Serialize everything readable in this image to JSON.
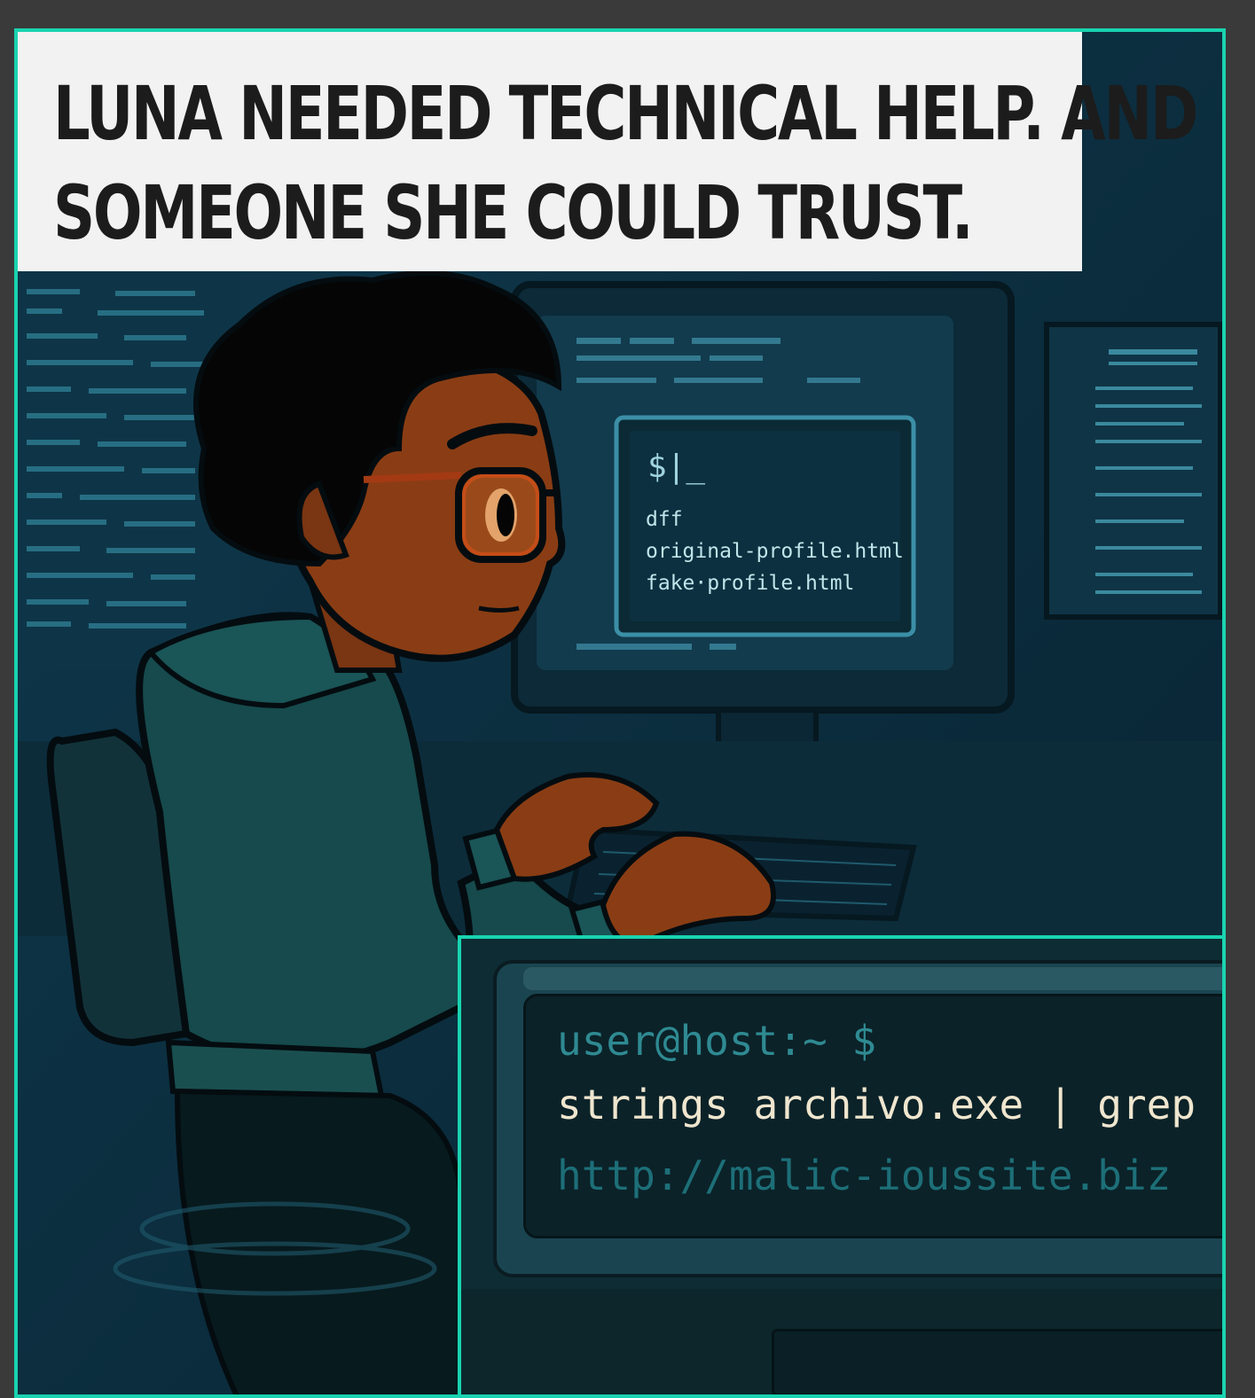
{
  "caption": {
    "line1": "LUNA NEEDED TECHNICAL HELP. AND",
    "line2": "SOMEONE SHE COULD TRUST."
  },
  "monitor": {
    "prompt": "$|_",
    "lines": [
      "dff",
      "original-profile.html",
      "fake·profile.html"
    ]
  },
  "terminal": {
    "prompt": "user@host:~ $",
    "command": "strings archivo.exe | grep htt",
    "output": "http://malic-ioussite.biz"
  },
  "colors": {
    "border_accent": "#19d3b0",
    "background": "#0b2a3a",
    "caption_bg": "#f2f2f2"
  }
}
